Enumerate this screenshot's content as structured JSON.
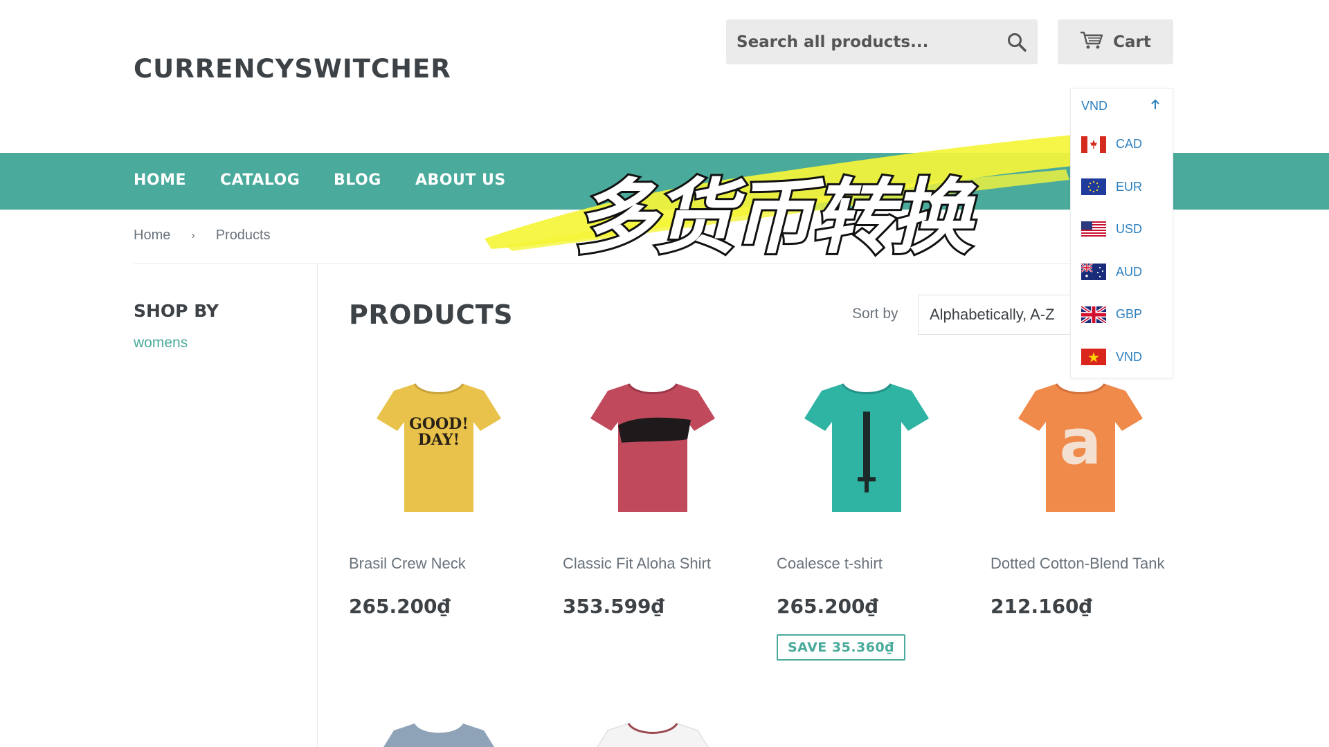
{
  "store": {
    "name": "CURRENCYSWITCHER"
  },
  "search": {
    "placeholder": "Search all products..."
  },
  "cart": {
    "label": "Cart"
  },
  "nav": [
    {
      "label": "HOME"
    },
    {
      "label": "CATALOG"
    },
    {
      "label": "BLOG"
    },
    {
      "label": "ABOUT US"
    }
  ],
  "banner": {
    "text": "多货币转换"
  },
  "breadcrumb": {
    "home": "Home",
    "separator": "›",
    "current": "Products"
  },
  "sidebar": {
    "heading": "SHOP BY",
    "tags": [
      "womens"
    ]
  },
  "main": {
    "title": "PRODUCTS",
    "sort_label": "Sort by",
    "sort_value": "Alphabetically, A-Z"
  },
  "currency": {
    "selected": "VND",
    "options": [
      {
        "code": "CAD",
        "flag": "flag-canada-icon"
      },
      {
        "code": "EUR",
        "flag": "flag-eu-icon"
      },
      {
        "code": "USD",
        "flag": "flag-usa-icon"
      },
      {
        "code": "AUD",
        "flag": "flag-australia-icon"
      },
      {
        "code": "GBP",
        "flag": "flag-uk-icon"
      },
      {
        "code": "VND",
        "flag": "flag-vietnam-icon"
      }
    ]
  },
  "products": [
    {
      "name": "Brasil Crew Neck",
      "price": "265.200₫",
      "shirt_color": "#e8c24a",
      "print": "GOOD DAY!"
    },
    {
      "name": "Classic Fit Aloha Shirt",
      "price": "353.599₫",
      "shirt_color": "#c04a5c",
      "print": ""
    },
    {
      "name": "Coalesce t-shirt",
      "price": "265.200₫",
      "save": "SAVE 35.360₫",
      "shirt_color": "#2fb3a3",
      "print": ""
    },
    {
      "name": "Dotted Cotton-Blend Tank",
      "price": "212.160₫",
      "shirt_color": "#f08a4b",
      "print": "a"
    }
  ],
  "partial_products": [
    {
      "shirt_color": "#8fa3b8"
    },
    {
      "shirt_color": "#f4f4f4"
    }
  ],
  "colors": {
    "accent": "#4aaa9b",
    "banner_highlight": "#f5f53a",
    "link": "#2c7fbf"
  }
}
